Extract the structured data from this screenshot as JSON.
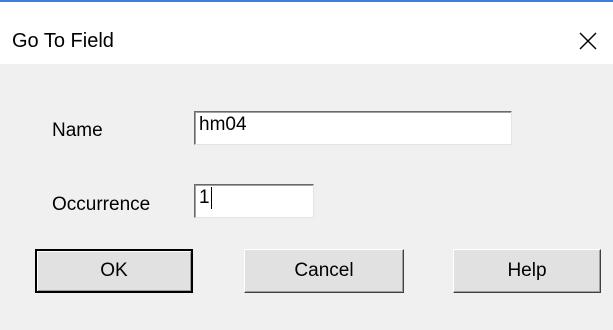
{
  "window": {
    "title": "Go To Field",
    "close_glyph": "✕"
  },
  "form": {
    "name_label": "Name",
    "name_value": "hm04",
    "occurrence_label": "Occurrence",
    "occurrence_value": "1"
  },
  "buttons": {
    "ok": "OK",
    "cancel": "Cancel",
    "help": "Help"
  },
  "icons": {
    "close": "close-icon"
  },
  "colors": {
    "accent": "#3c7ed8",
    "title_bg": "#ffffff",
    "dialog_bg": "#f0f0f0",
    "button_bg": "#e1e1e1"
  }
}
